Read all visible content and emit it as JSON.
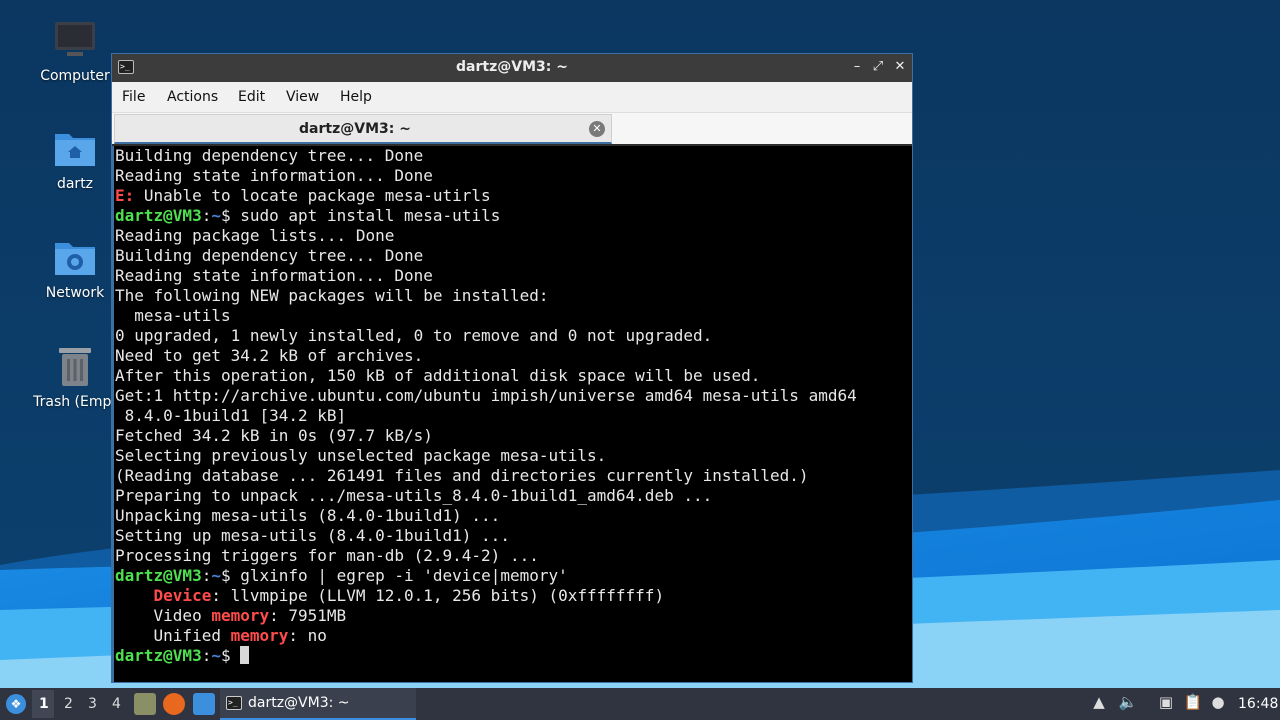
{
  "desktop": {
    "icons": [
      {
        "label": "Computer"
      },
      {
        "label": "dartz"
      },
      {
        "label": "Network"
      },
      {
        "label": "Trash (Empt"
      }
    ]
  },
  "window": {
    "title": "dartz@VM3: ~",
    "menu": [
      "File",
      "Actions",
      "Edit",
      "View",
      "Help"
    ],
    "tab_title": "dartz@VM3: ~"
  },
  "terminal": {
    "prompt_user": "dartz@VM3",
    "prompt_path": "~",
    "lines": [
      "Building dependency tree... Done",
      "Reading state information... Done",
      "Unable to locate package mesa-utirls",
      "sudo apt install mesa-utils",
      "Reading package lists... Done",
      "Building dependency tree... Done",
      "Reading state information... Done",
      "The following NEW packages will be installed:",
      "  mesa-utils",
      "0 upgraded, 1 newly installed, 0 to remove and 0 not upgraded.",
      "Need to get 34.2 kB of archives.",
      "After this operation, 150 kB of additional disk space will be used.",
      "Get:1 http://archive.ubuntu.com/ubuntu impish/universe amd64 mesa-utils amd64",
      " 8.4.0-1build1 [34.2 kB]",
      "Fetched 34.2 kB in 0s (97.7 kB/s)",
      "Selecting previously unselected package mesa-utils.",
      "(Reading database ... 261491 files and directories currently installed.)",
      "Preparing to unpack .../mesa-utils_8.4.0-1build1_amd64.deb ...",
      "Unpacking mesa-utils (8.4.0-1build1) ...",
      "Setting up mesa-utils (8.4.0-1build1) ...",
      "Processing triggers for man-db (2.9.4-2) ...",
      "glxinfo | egrep -i 'device|memory'",
      "llvmpipe (LLVM 12.0.1, 256 bits) (0xffffffff)",
      "7951MB",
      "no"
    ],
    "error_prefix": "E:",
    "hl_device": "Device",
    "hl_memory": "memory",
    "video_label": "Video ",
    "unified_label": "Unified "
  },
  "taskbar": {
    "workspaces": [
      "1",
      "2",
      "3",
      "4"
    ],
    "task_label": "dartz@VM3: ~",
    "clock": "16:48"
  }
}
